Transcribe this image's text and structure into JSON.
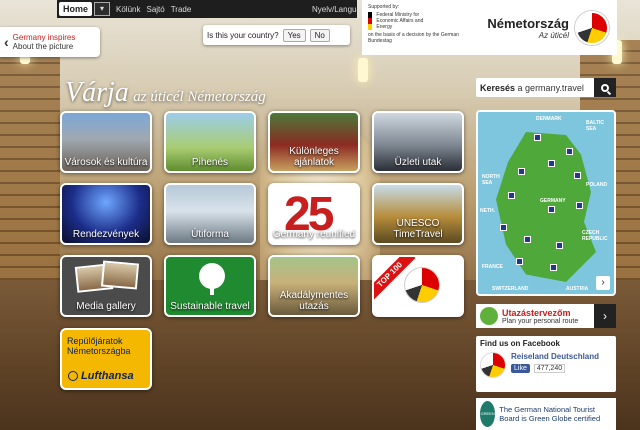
{
  "topbar": {
    "home_label": "Home",
    "dropdown_icon": "chevron-down-icon",
    "links": [
      "Kölünk",
      "Sajtó",
      "Trade"
    ],
    "language_label": "Nyelv/Language"
  },
  "country_prompt": {
    "question": "Is this your country?",
    "yes": "Yes",
    "no": "No"
  },
  "inspires": {
    "title": "Germany inspires",
    "subtitle": "About the picture"
  },
  "header": {
    "ministry_supported": "Supported by:",
    "ministry_name": "Federal Ministry for Economic Affairs and Energy",
    "ministry_note": "on the basis of a decision by the German Bundestag",
    "brand_name": "Németország",
    "brand_tagline": "Az úticél"
  },
  "headline": {
    "big": "Várja",
    "small": "az úticél Németország"
  },
  "tiles": {
    "city": "Városok és kultúra",
    "relax": "Pihenés",
    "special": "Különleges ajánlatok",
    "business": "Üzleti utak",
    "events": "Rendezvények",
    "outdoor": "Útiforma",
    "reunified": "Germany reunified",
    "reunified_number": "25",
    "unesco": "UNESCO TimeTravel",
    "media": "Media gallery",
    "sustain": "Sustainable travel",
    "access": "Akadálymentes utazás",
    "top100_ribbon": "TOP 100"
  },
  "lufthansa": {
    "text": "Repülőjáratok Németországba",
    "brand": "Lufthansa"
  },
  "search": {
    "label": "Keresés",
    "domain": "a germany.travel"
  },
  "map": {
    "labels": {
      "denmark": "DENMARK",
      "baltic": "BALTIC SEA",
      "north": "NORTH SEA",
      "germany": "GERMANY",
      "poland": "POLAND",
      "czech": "CZECH REPUBLIC",
      "france": "FRANCE",
      "switzerland": "SWITZERLAND",
      "austria": "AUSTRIA",
      "netherlands": "NETH."
    }
  },
  "planner": {
    "title": "Utazástervezőm",
    "subtitle": "Plan your personal route"
  },
  "facebook": {
    "heading": "Find us on Facebook",
    "page": "Reiseland Deutschland",
    "like": "Like",
    "count": "477,240"
  },
  "gnto": {
    "badge": "GREEN GLOBE",
    "text": "The German National Tourist Board is Green Globe certified"
  },
  "colors": {
    "accent_red": "#c81e1e",
    "dark": "#222222",
    "map_land": "#4fa83a",
    "lufthansa_yellow": "#f5b800"
  }
}
